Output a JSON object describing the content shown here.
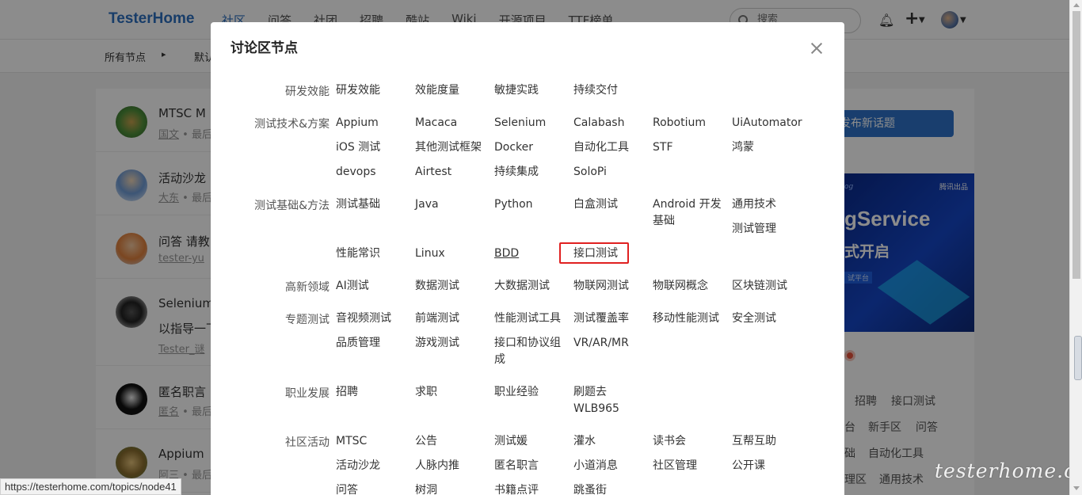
{
  "header": {
    "brand": "TesterHome",
    "nav": [
      "社区",
      "问答",
      "社团",
      "招聘",
      "酷站",
      "Wiki",
      "开源项目",
      "TTF榜单"
    ],
    "search_placeholder": "搜索"
  },
  "subbar": {
    "all_nodes": "所有节点",
    "default": "默认"
  },
  "topics": [
    {
      "title": "MTSC  M",
      "meta_user": "国文",
      "meta_rest": " • 最后"
    },
    {
      "title": "活动沙龙",
      "meta_user": "大东",
      "meta_rest": " • 最后"
    },
    {
      "title": "问答  请教",
      "meta_user": "tester-yu",
      "meta_rest": ""
    },
    {
      "title": "Selenium",
      "title2": "以指导一下",
      "meta_user": "Tester_谜",
      "meta_rest": ""
    },
    {
      "title": "匿名职言",
      "meta_user": "匿名",
      "meta_rest": " • 最后"
    },
    {
      "title": "Appium",
      "meta_user": "阿三",
      "meta_rest": " • 最后"
    }
  ],
  "sidebar": {
    "new_topic": "发布新话题",
    "banner": {
      "line1": "gService",
      "line2": "式开启",
      "tag": "腾讯出品",
      "small": "og",
      "sub": "试平台"
    },
    "tags": [
      "招聘",
      "接口测试",
      "台",
      "新手区",
      "问答",
      "础",
      "自动化工具",
      "理区",
      "通用技术"
    ]
  },
  "watermark": "testerhome.com",
  "status_url": "https://testerhome.com/topics/node41",
  "modal": {
    "title": "讨论区节点",
    "sections": [
      {
        "label": "研发效能",
        "nodes": [
          "研发效能",
          "效能度量",
          "敏捷实践",
          "持续交付"
        ]
      },
      {
        "label": "测试技术&方案",
        "nodes": [
          "Appium",
          "Macaca",
          "Selenium",
          "Calabash",
          "Robotium",
          "UiAutomator",
          "iOS 测试",
          "其他测试框架",
          "Docker",
          "自动化工具",
          "STF",
          "鸿蒙",
          "devops",
          "Airtest",
          "持续集成",
          "SoloPi"
        ]
      },
      {
        "label": "测试基础&方法",
        "nodes": [
          "测试基础",
          "Java",
          "Python",
          "白盒测试",
          "Android 开发基础",
          "通用技术",
          "测试管理",
          "性能常识",
          "Linux",
          "BDD",
          "接口测试"
        ]
      },
      {
        "label": "高新领域",
        "nodes": [
          "AI测试",
          "数据测试",
          "大数据测试",
          "物联网测试",
          "物联网概念",
          "区块链测试"
        ]
      },
      {
        "label": "专题测试",
        "nodes": [
          "音视频测试",
          "前端测试",
          "性能测试工具",
          "测试覆盖率",
          "移动性能测试",
          "安全测试",
          "品质管理",
          "游戏测试",
          "接口和协议组成",
          "VR/AR/MR"
        ]
      },
      {
        "label": "职业发展",
        "nodes": [
          "招聘",
          "求职",
          "职业经验",
          "刷题去WLB965"
        ]
      },
      {
        "label": "社区活动",
        "nodes": [
          "MTSC",
          "公告",
          "测试媛",
          "灌水",
          "读书会",
          "互帮互助",
          "活动沙龙",
          "人脉内推",
          "匿名职言",
          "小道消息",
          "社区管理",
          "公开课",
          "问答",
          "树洞",
          "书籍点评",
          "跳蚤街"
        ]
      }
    ]
  }
}
